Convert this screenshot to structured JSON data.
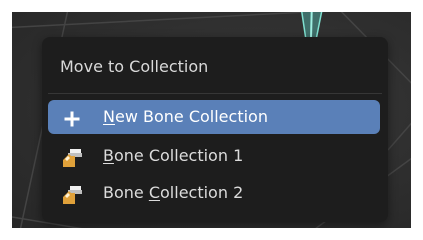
{
  "menu": {
    "title": "Move to Collection",
    "items": [
      {
        "icon": "plus-icon",
        "before": "",
        "mnemonic": "N",
        "after": "ew Bone Collection",
        "active": true
      },
      {
        "icon": "bone-collection-icon",
        "before": "",
        "mnemonic": "B",
        "after": "one Collection 1",
        "active": false
      },
      {
        "icon": "bone-collection-icon",
        "before": "Bone ",
        "mnemonic": "C",
        "after": "ollection 2",
        "active": false
      }
    ]
  },
  "colors": {
    "menu_background": "#1d1d1d",
    "highlight": "#5a80b8",
    "text": "#dcdcdc",
    "icon_orange": "#e0a13a",
    "bone_cyan": "#7fe0d0"
  }
}
